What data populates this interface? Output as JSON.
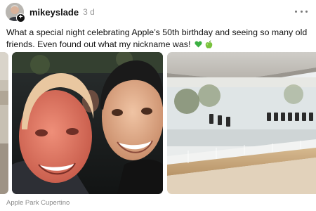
{
  "post": {
    "username": "mikeyslade",
    "timestamp": "3 d",
    "text": "What a special night celebrating Apple’s 50th birthday and seeing so many old friends. Even found out what my nickname was!",
    "emoji": [
      "green-heart",
      "green-apple"
    ],
    "location": "Apple Park Cupertino"
  },
  "colors": {
    "username": "#111111",
    "timestamp": "#9a9a9a",
    "emoji_green": "#34b233"
  },
  "icons": [
    "avatar",
    "plus-icon",
    "more-options-icon",
    "green-heart-icon",
    "green-apple-icon"
  ]
}
